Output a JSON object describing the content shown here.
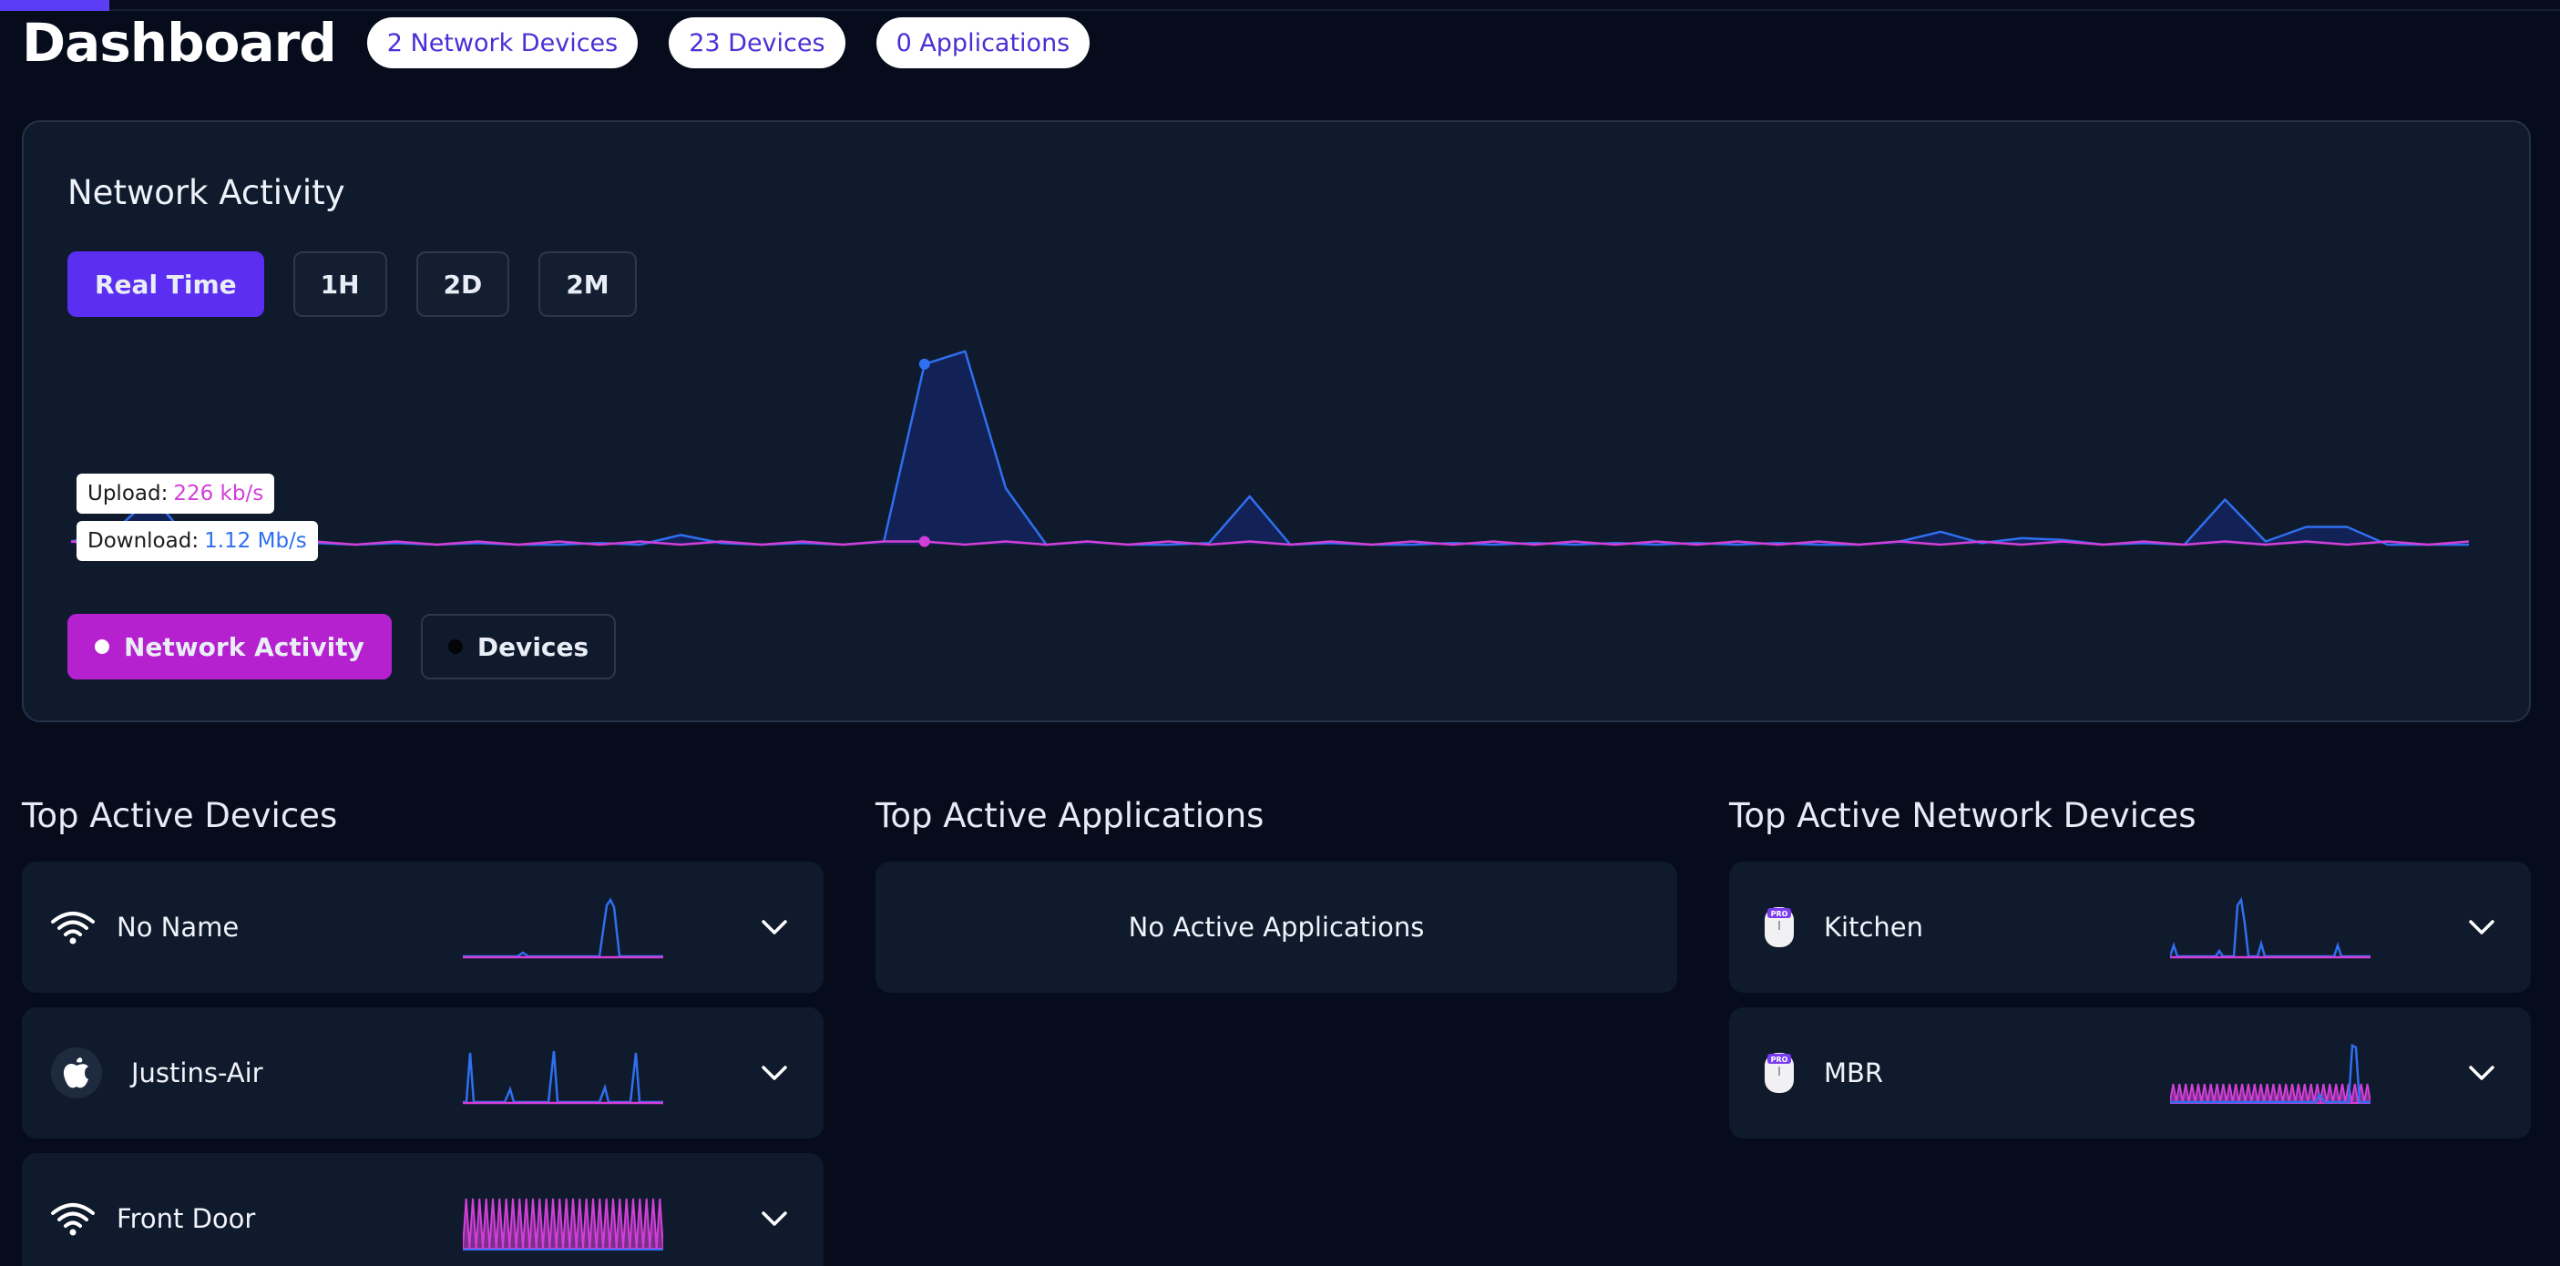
{
  "header": {
    "title": "Dashboard",
    "badges": {
      "network_devices": "2 Network Devices",
      "devices": "23 Devices",
      "applications": "0 Applications"
    }
  },
  "activity": {
    "title": "Network Activity",
    "ranges": {
      "realtime": "Real Time",
      "h1": "1H",
      "d2": "2D",
      "m2": "2M"
    },
    "active_range": "Real Time",
    "tooltip": {
      "upload_label": "Upload:",
      "upload_value": "226 kb/s",
      "download_label": "Download: ",
      "download_value": "1.12 Mb/s"
    },
    "legend": {
      "network": "Network Activity",
      "devices": "Devices"
    }
  },
  "chart_data": {
    "type": "area",
    "x_count": 60,
    "ylim": [
      0,
      1.3
    ],
    "series": [
      {
        "values": [
          0.02,
          0.07,
          0.3,
          0.0,
          0.01,
          0.0,
          0.01,
          0.0,
          0.01,
          0.0,
          0.01,
          0.0,
          0.0,
          0.01,
          0.0,
          0.06,
          0.01,
          0.0,
          0.01,
          0.0,
          0.02,
          1.12,
          1.2,
          0.35,
          0.0,
          0.02,
          0.0,
          0.0,
          0.01,
          0.3,
          0.0,
          0.01,
          0.0,
          0.0,
          0.01,
          0.0,
          0.01,
          0.0,
          0.01,
          0.0,
          0.01,
          0.0,
          0.01,
          0.0,
          0.0,
          0.02,
          0.08,
          0.01,
          0.04,
          0.03,
          0.0,
          0.01,
          0.0,
          0.28,
          0.02,
          0.11,
          0.11,
          0.0,
          0.0,
          0.0
        ]
      },
      {
        "values": [
          0.02,
          0.0,
          0.02,
          0.0,
          0.02,
          0.0,
          0.02,
          0.0,
          0.02,
          0.0,
          0.02,
          0.0,
          0.02,
          0.0,
          0.02,
          0.0,
          0.02,
          0.0,
          0.02,
          0.0,
          0.02,
          0.02,
          0.0,
          0.02,
          0.0,
          0.02,
          0.0,
          0.02,
          0.0,
          0.02,
          0.0,
          0.02,
          0.0,
          0.02,
          0.0,
          0.02,
          0.0,
          0.02,
          0.0,
          0.02,
          0.0,
          0.02,
          0.0,
          0.02,
          0.0,
          0.02,
          0.0,
          0.02,
          0.0,
          0.02,
          0.0,
          0.02,
          0.0,
          0.02,
          0.0,
          0.02,
          0.0,
          0.02,
          0.0,
          0.02
        ]
      }
    ],
    "colors": {
      "download": "#2f6ff0",
      "upload": "#d23fd8"
    }
  },
  "sections": {
    "devices_title": "Top Active Devices",
    "apps_title": "Top Active Applications",
    "netdev_title": "Top Active Network Devices"
  },
  "devices": [
    {
      "name": "No Name",
      "icon": "wifi-icon"
    },
    {
      "name": "Justins-Air",
      "icon": "apple-icon"
    },
    {
      "name": "Front Door",
      "icon": "wifi-icon"
    }
  ],
  "apps_empty": "No Active Applications",
  "network_devices": [
    {
      "name": "Kitchen",
      "icon": "access-point-icon",
      "badge": "PRO"
    },
    {
      "name": "MBR",
      "icon": "access-point-icon",
      "badge": "PRO"
    }
  ],
  "colors": {
    "accent": "#5b2ef2",
    "magenta": "#b520cf",
    "background": "#070c1c",
    "card": "#0f1a2c"
  }
}
